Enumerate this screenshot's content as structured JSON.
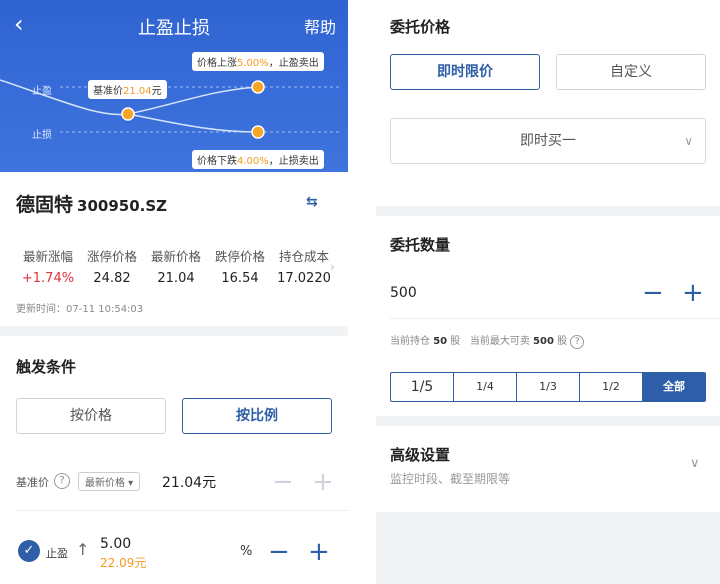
{
  "header": {
    "back_icon": "chevron-left-icon",
    "title": "止盈止损",
    "help_label": "帮助"
  },
  "chart": {
    "take_profit_label": "止盈",
    "stop_loss_label": "止损",
    "base_tip_prefix": "基准价",
    "base_price": "21.04",
    "base_tip_suffix": "元",
    "up_tip_prefix": "价格上涨",
    "up_pct": "5.00%",
    "up_tip_suffix": "，止盈卖出",
    "down_tip_prefix": "价格下跌",
    "down_pct": "4.00%",
    "down_tip_suffix": "，止损卖出",
    "accent_color": "#f59a23"
  },
  "stock": {
    "name": "德固特",
    "code": "300950.SZ",
    "swap_icon": "swap-icon",
    "quotes": [
      {
        "label": "最新涨幅",
        "value": "+1.74%"
      },
      {
        "label": "涨停价格",
        "value": "24.82"
      },
      {
        "label": "最新价格",
        "value": "21.04"
      },
      {
        "label": "跌停价格",
        "value": "16.54"
      },
      {
        "label": "持仓成本",
        "value": "17.0220"
      }
    ],
    "update_time": "更新时间：07-11 10:54:03"
  },
  "trigger": {
    "title": "触发条件",
    "by_price_label": "按价格",
    "by_ratio_label": "按比例",
    "base_label": "基准价",
    "base_select": "最新价格",
    "base_value": "21.04元",
    "tp_label": "止盈",
    "tp_pct": "5.00",
    "tp_price": "22.09元",
    "pct_unit": "%"
  },
  "order_price": {
    "title": "委托价格",
    "instant_limit_label": "即时限价",
    "custom_label": "自定义",
    "select_value": "即时买一"
  },
  "quantity": {
    "title": "委托数量",
    "value": "500",
    "holding_prefix": "当前持仓",
    "holding_value": "50",
    "holding_unit": "股",
    "max_prefix": "当前最大可卖",
    "max_value": "500",
    "max_unit": "股",
    "fractions": [
      "1/5",
      "1/4",
      "1/3",
      "1/2",
      "全部"
    ]
  },
  "advanced": {
    "title": "高级设置",
    "subtitle": "监控时段、截至期限等"
  },
  "colors": {
    "primary": "#2f5ea8",
    "header_bg": "#3a6ed8",
    "up_red": "#e0333a"
  }
}
